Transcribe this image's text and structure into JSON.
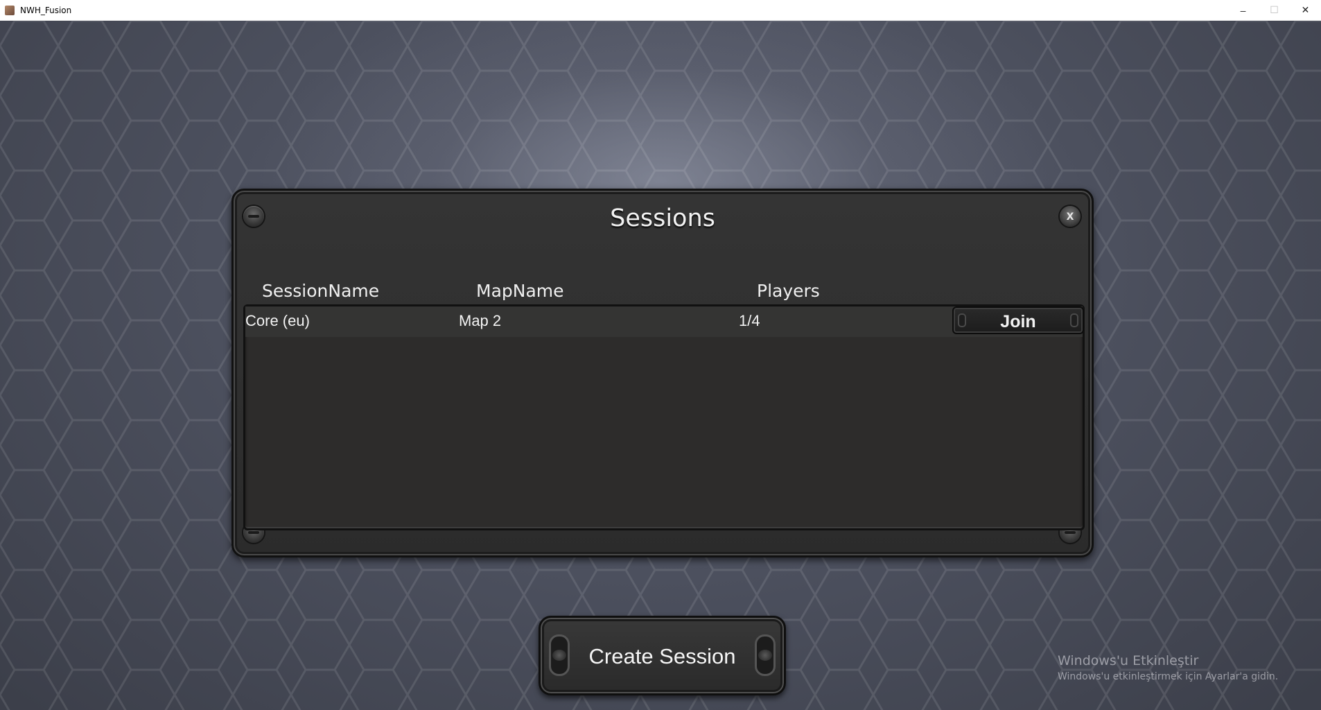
{
  "window": {
    "title": "NWH_Fusion",
    "controls": [
      "minimize-icon",
      "maximize-icon",
      "close-icon"
    ],
    "minimize_glyph": "–",
    "maximize_glyph": "☐",
    "close_glyph": "✕"
  },
  "panel": {
    "title": "Sessions",
    "close_glyph": "x",
    "columns": {
      "session_name": "SessionName",
      "map_name": "MapName",
      "players": "Players"
    },
    "rows": [
      {
        "session_name": "Core (eu)",
        "map_name": "Map 2",
        "players": "1/4",
        "join_label": "Join"
      }
    ]
  },
  "create_button": {
    "label": "Create Session"
  },
  "watermark": {
    "title": "Windows'u Etkinleştir",
    "subtitle": "Windows'u etkinleştirmek için Ayarlar'a gidin."
  },
  "colors": {
    "background": "#4a4e5c",
    "panel": "#2f2f2f",
    "text": "#f2f2f2"
  }
}
